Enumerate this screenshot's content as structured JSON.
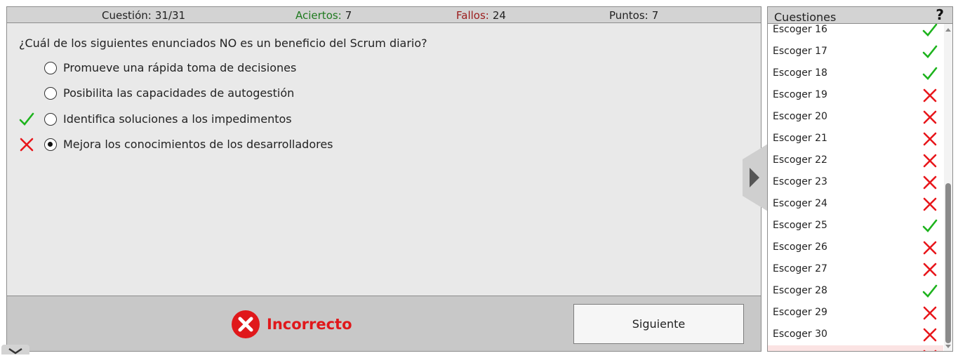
{
  "stats": {
    "question_label": "Cuestión:",
    "question_value": "31/31",
    "correct_label": "Aciertos:",
    "correct_value": "7",
    "wrong_label": "Fallos:",
    "wrong_value": "24",
    "points_label": "Puntos:",
    "points_value": "7"
  },
  "question": "¿Cuál de los siguientes enunciados NO es un beneficio del Scrum diario?",
  "options": [
    {
      "text": "Promueve una rápida toma de decisiones",
      "selected": false,
      "mark": ""
    },
    {
      "text": "Posibilita las capacidades de autogestión",
      "selected": false,
      "mark": ""
    },
    {
      "text": "Identifica soluciones a los impedimentos",
      "selected": false,
      "mark": "correct"
    },
    {
      "text": "Mejora los conocimientos de los desarrolladores",
      "selected": true,
      "mark": "wrong"
    }
  ],
  "result": {
    "text": "Incorrecto",
    "icon": "error-circle-icon"
  },
  "next_button": "Siguiente",
  "sidebar": {
    "title": "Cuestiones",
    "help": "?",
    "items": [
      {
        "label": "Escoger 16",
        "status": "correct"
      },
      {
        "label": "Escoger 17",
        "status": "correct"
      },
      {
        "label": "Escoger 18",
        "status": "correct"
      },
      {
        "label": "Escoger 19",
        "status": "wrong"
      },
      {
        "label": "Escoger 20",
        "status": "wrong"
      },
      {
        "label": "Escoger 21",
        "status": "wrong"
      },
      {
        "label": "Escoger 22",
        "status": "wrong"
      },
      {
        "label": "Escoger 23",
        "status": "wrong"
      },
      {
        "label": "Escoger 24",
        "status": "wrong"
      },
      {
        "label": "Escoger 25",
        "status": "correct"
      },
      {
        "label": "Escoger 26",
        "status": "wrong"
      },
      {
        "label": "Escoger 27",
        "status": "wrong"
      },
      {
        "label": "Escoger 28",
        "status": "correct"
      },
      {
        "label": "Escoger 29",
        "status": "wrong"
      },
      {
        "label": "Escoger 30",
        "status": "wrong"
      },
      {
        "label": "",
        "status": "wrong"
      }
    ]
  },
  "colors": {
    "correct": "#1db31d",
    "wrong": "#e8161b",
    "accent_red": "#e0181b"
  }
}
